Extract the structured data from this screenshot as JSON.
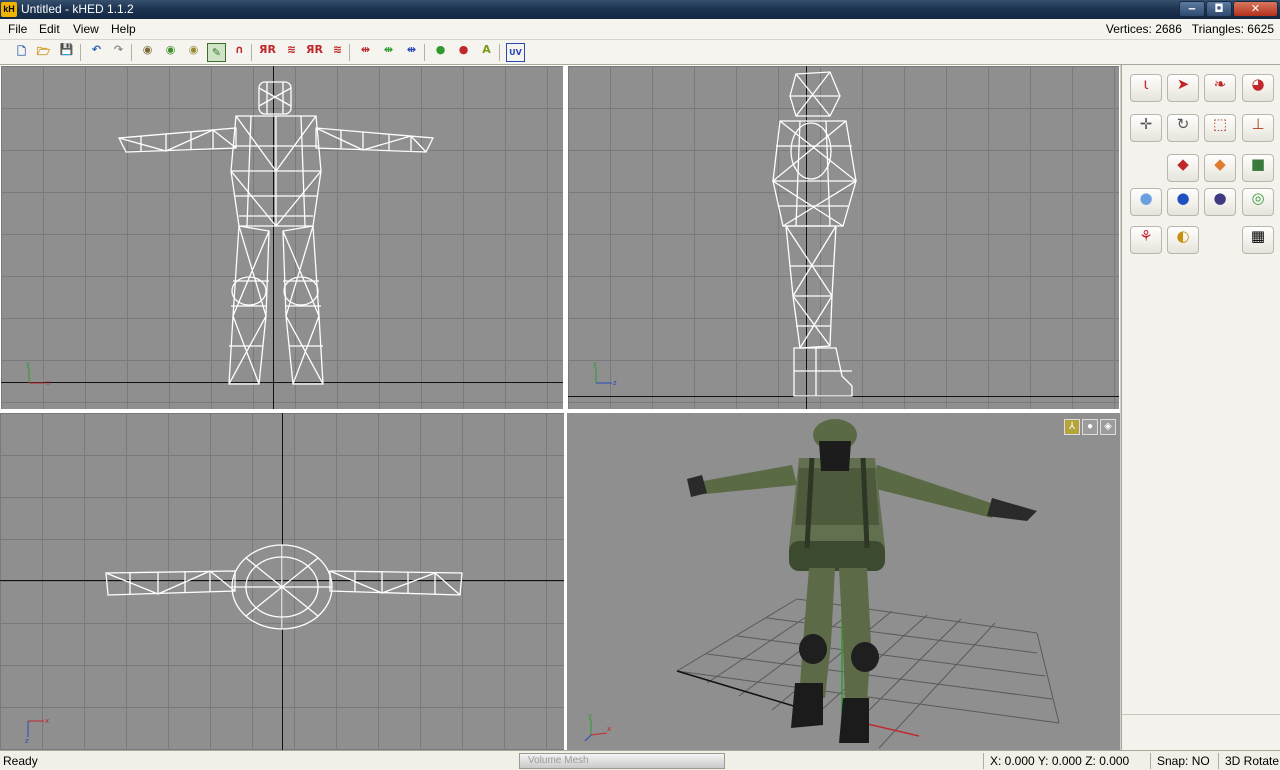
{
  "window": {
    "title": "Untitled - kHED 1.1.2",
    "app_icon": "kH",
    "controls": {
      "minimize": "‒",
      "maximize": "◘",
      "close": "✕"
    }
  },
  "menu": {
    "items": [
      "File",
      "Edit",
      "View",
      "Help"
    ]
  },
  "stats": {
    "vertices": "Vertices: 2686",
    "triangles": "Triangles: 6625"
  },
  "toolbar": {
    "buttons": [
      {
        "name": "new-file-icon",
        "glyph": "🗋",
        "color": "#2a5fb0"
      },
      {
        "name": "open-folder-icon",
        "glyph": "🗁",
        "color": "#c89010"
      },
      {
        "name": "save-icon",
        "glyph": "💾",
        "color": "#2a4fa0"
      },
      {
        "name": "undo-icon",
        "glyph": "↶",
        "color": "#2a5fb0"
      },
      {
        "name": "redo-icon",
        "glyph": "↷",
        "color": "#8a8a8a"
      },
      {
        "name": "open-model-icon",
        "glyph": "◉",
        "color": "#7a6a3a"
      },
      {
        "name": "import-model-icon",
        "glyph": "◉",
        "color": "#3f8f2a"
      },
      {
        "name": "export-model-icon",
        "glyph": "◉",
        "color": "#9a8a3a"
      },
      {
        "name": "paint-tool-icon",
        "glyph": "✎",
        "color": "#2e7d1e"
      },
      {
        "name": "magnet-icon",
        "glyph": "∩",
        "color": "#c0282b"
      },
      {
        "name": "mirror-x-icon",
        "glyph": "ЯR",
        "color": "#c0282b"
      },
      {
        "name": "mirror-y-icon",
        "glyph": "≋",
        "color": "#c0282b"
      },
      {
        "name": "mirror-z-icon",
        "glyph": "ЯR",
        "color": "#c0282b"
      },
      {
        "name": "flip-icon",
        "glyph": "≋",
        "color": "#c0282b"
      },
      {
        "name": "weld-x-icon",
        "glyph": "⇹",
        "color": "#c0282b"
      },
      {
        "name": "weld-y-icon",
        "glyph": "⇹",
        "color": "#2e9a2e"
      },
      {
        "name": "weld-z-icon",
        "glyph": "⇹",
        "color": "#2848b8"
      },
      {
        "name": "add-object-icon",
        "glyph": "●",
        "color": "#2e9a2e"
      },
      {
        "name": "remove-object-icon",
        "glyph": "●",
        "color": "#c0282b"
      },
      {
        "name": "object-a-icon",
        "glyph": "A",
        "color": "#7a9a1a"
      },
      {
        "name": "uv-editor-icon",
        "glyph": "UV",
        "color": "#2848b8"
      }
    ]
  },
  "viewports": {
    "front": {
      "name": "front-viewport",
      "axis_labels": [
        "y",
        "x"
      ]
    },
    "side": {
      "name": "side-viewport",
      "axis_labels": [
        "y",
        "z"
      ]
    },
    "top": {
      "name": "top-viewport",
      "axis_labels": [
        "x",
        "z"
      ]
    },
    "perspective": {
      "name": "perspective-viewport",
      "axis_labels": [
        "y",
        "x",
        "z"
      ]
    }
  },
  "panel": {
    "rows": [
      [
        {
          "name": "select-vertex-icon",
          "glyph": "ɩ",
          "color": "#c0282b"
        },
        {
          "name": "select-arrow-icon",
          "glyph": "➤",
          "color": "#c0282b"
        },
        {
          "name": "select-face-icon",
          "glyph": "❧",
          "color": "#c0282b"
        },
        {
          "name": "select-object-icon",
          "glyph": "◕",
          "color": "#c0282b"
        }
      ],
      [
        {
          "name": "move-icon",
          "glyph": "✛",
          "color": "#555555"
        },
        {
          "name": "rotate-icon",
          "glyph": "↻",
          "color": "#555555"
        },
        {
          "name": "scale-icon",
          "glyph": "⬚",
          "color": "#b04020"
        },
        {
          "name": "bone-icon",
          "glyph": "⊥",
          "color": "#b04020"
        }
      ],
      [
        null,
        {
          "name": "plane-red-icon",
          "glyph": "◆",
          "color": "#c0282b"
        },
        {
          "name": "plane-orange-icon",
          "glyph": "◆",
          "color": "#e07a30"
        },
        {
          "name": "box-icon",
          "glyph": "■",
          "color": "#3a7a3a"
        }
      ],
      [
        {
          "name": "sphere-white-icon",
          "glyph": "●",
          "color": "#6aa0e0"
        },
        {
          "name": "sphere-blue-icon",
          "glyph": "●",
          "color": "#2050c0"
        },
        {
          "name": "sphere-dark-icon",
          "glyph": "●",
          "color": "#403a80"
        },
        {
          "name": "torus-icon",
          "glyph": "◎",
          "color": "#3a9a3a"
        }
      ],
      [
        {
          "name": "weld-vertices-icon",
          "glyph": "⚘",
          "color": "#c0282b"
        },
        {
          "name": "cap-icon",
          "glyph": "◐",
          "color": "#c89010"
        },
        null,
        {
          "name": "checker-texture-icon",
          "glyph": "▦",
          "color": "#000000"
        }
      ]
    ]
  },
  "status": {
    "message": "Ready",
    "progress_label": "Volume Mesh",
    "coords": "X: 0.000 Y: 0.000 Z: 0.000",
    "snap": "Snap: NO",
    "mode": "3D Rotate"
  },
  "colors": {
    "viewport_bg": "#8f8f8f",
    "grid": "#7a7a7a",
    "wireframe": "#ffffff",
    "title_bar": "#1d3553",
    "menu_bg": "#f5f4ee"
  }
}
